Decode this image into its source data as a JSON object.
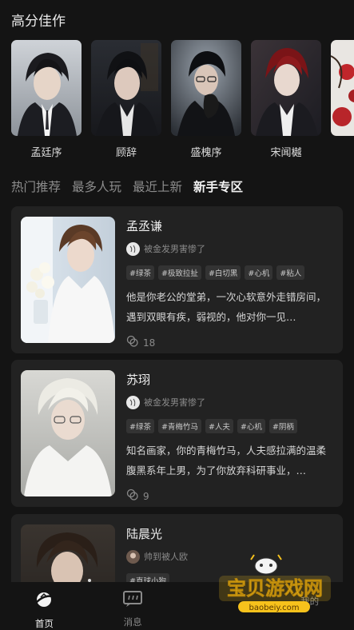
{
  "section": {
    "title": "高分佳作"
  },
  "featured": [
    {
      "name": "孟廷序"
    },
    {
      "name": "顾辞"
    },
    {
      "name": "盛槐序"
    },
    {
      "name": "宋闻樾"
    },
    {
      "name": ""
    }
  ],
  "tabs": [
    {
      "label": "热门推荐",
      "active": false
    },
    {
      "label": "最多人玩",
      "active": false
    },
    {
      "label": "最近上新",
      "active": false
    },
    {
      "label": "新手专区",
      "active": true
    }
  ],
  "cards": [
    {
      "name": "孟丞谦",
      "author": "被金发男害惨了",
      "tags": [
        "#绿茶",
        "#极致拉扯",
        "#白切黑",
        "#心机",
        "#粘人"
      ],
      "description": "他是你老公的堂弟，一次心软意外走错房间，遇到双眼有疾，弱视的，他对你一见…",
      "count": "18"
    },
    {
      "name": "苏珝",
      "author": "被金发男害惨了",
      "tags": [
        "#绿茶",
        "#青梅竹马",
        "#人夫",
        "#心机",
        "#阴柄"
      ],
      "description": "知名画家，你的青梅竹马，人夫感拉满的温柔腹黑系年上男，为了你放弃科研事业，…",
      "count": "9"
    },
    {
      "name": "陆晨光",
      "author": "帅到被人欧",
      "tags": [
        "#直球小狗"
      ],
      "description": "",
      "count": ""
    }
  ],
  "nav": [
    {
      "label": "首页",
      "icon": "home-icon",
      "active": true
    },
    {
      "label": "消息",
      "icon": "message-icon",
      "active": false
    },
    {
      "label": "",
      "icon": "",
      "active": false
    },
    {
      "label": "我的",
      "icon": "profile-icon",
      "active": false
    }
  ],
  "watermark": {
    "text": "宝贝游戏网",
    "url": "baobeiy.com"
  },
  "colors": {
    "background": "#141414",
    "card": "#222222",
    "tag_bg": "#333333",
    "watermark_red": "#e23a2e",
    "watermark_yellow": "#f7c21c"
  }
}
